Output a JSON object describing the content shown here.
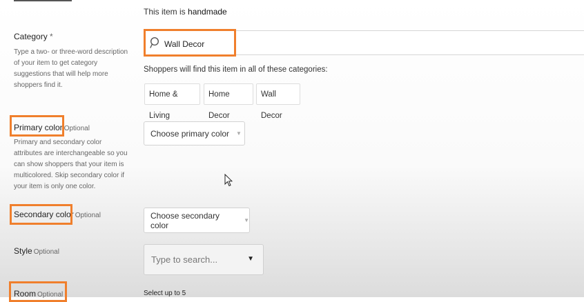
{
  "handmade": {
    "prefix": "This item is ",
    "value": "handmade"
  },
  "category": {
    "label": "Category",
    "required_mark": "*",
    "description": "Type a two- or three-word description of your item to get category suggestions that will help more shoppers find it.",
    "search_value": "Wall Decor",
    "shoppers_text": "Shoppers will find this item in all of these categories:",
    "chips": [
      "Home & Living",
      "Home Decor",
      "Wall Decor"
    ]
  },
  "primary_color": {
    "label": "Primary color",
    "optional": "Optional",
    "description": "Primary and secondary color attributes are interchangeable so you can show shoppers that your item is multicolored. Skip secondary color if your item is only one color.",
    "select_label": "Choose primary color"
  },
  "secondary_color": {
    "label": "Secondary color",
    "optional": "Optional",
    "select_label": "Choose secondary color"
  },
  "style": {
    "label": "Style",
    "optional": "Optional",
    "placeholder": "Type to search..."
  },
  "room": {
    "label": "Room",
    "optional": "Optional",
    "hint": "Select up to 5"
  },
  "colors": {
    "highlight": "#f07f2c"
  },
  "icons": {
    "search": "search-icon",
    "caret": "chevron-down-icon",
    "cursor": "mouse-pointer-icon"
  }
}
